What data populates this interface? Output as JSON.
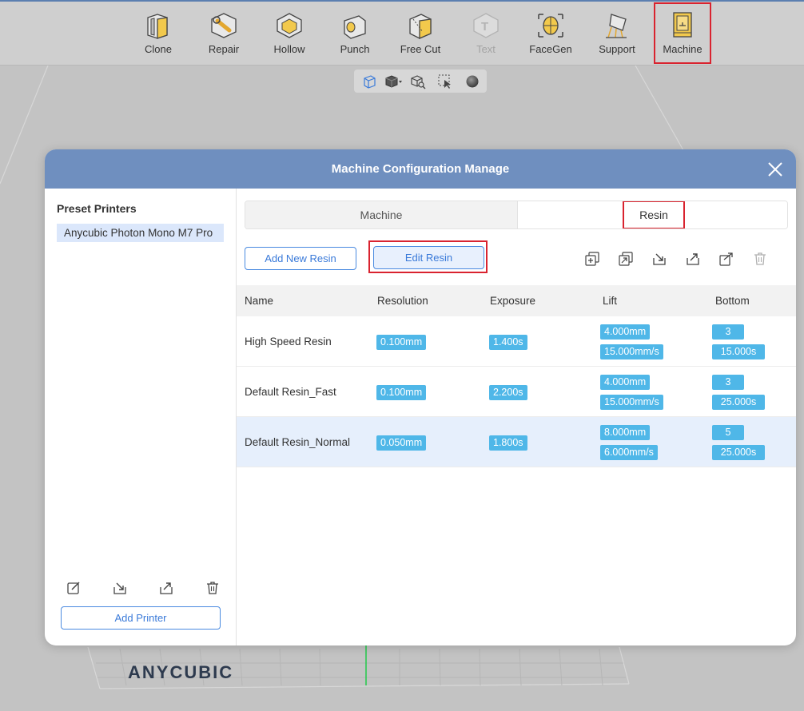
{
  "toolbar": {
    "tools": [
      {
        "label": "Clone",
        "icon": "clone-icon"
      },
      {
        "label": "Repair",
        "icon": "repair-icon"
      },
      {
        "label": "Hollow",
        "icon": "hollow-icon"
      },
      {
        "label": "Punch",
        "icon": "punch-icon"
      },
      {
        "label": "Free Cut",
        "icon": "free-cut-icon"
      },
      {
        "label": "Text",
        "icon": "text-icon",
        "disabled": true
      },
      {
        "label": "FaceGen",
        "icon": "facegen-icon"
      },
      {
        "label": "Support",
        "icon": "support-icon"
      },
      {
        "label": "Machine",
        "icon": "machine-icon",
        "selected": true
      }
    ]
  },
  "viewbar": {
    "icons": [
      "wireframe-view-icon",
      "shaded-view-icon",
      "inspect-view-icon",
      "select-view-icon",
      "sphere-view-icon"
    ]
  },
  "dialog": {
    "title": "Machine Configuration Manage",
    "left": {
      "preset_title": "Preset Printers",
      "printers": [
        "Anycubic Photon Mono M7 Pro"
      ],
      "add_printer": "Add Printer"
    },
    "tabs": {
      "machine": "Machine",
      "resin": "Resin"
    },
    "add_new_resin": "Add New Resin",
    "edit_resin": "Edit Resin",
    "table": {
      "headers": [
        "Name",
        "Resolution",
        "Exposure",
        "Lift",
        "Bottom"
      ],
      "rows": [
        {
          "name": "High Speed Resin",
          "resolution": "0.100mm",
          "exposure": "1.400s",
          "lift_height": "4.000mm",
          "lift_speed": "15.000mm/s",
          "bottom_layers": "3",
          "bottom_exposure": "15.000s"
        },
        {
          "name": "Default Resin_Fast",
          "resolution": "0.100mm",
          "exposure": "2.200s",
          "lift_height": "4.000mm",
          "lift_speed": "15.000mm/s",
          "bottom_layers": "3",
          "bottom_exposure": "25.000s"
        },
        {
          "name": "Default Resin_Normal",
          "resolution": "0.050mm",
          "exposure": "1.800s",
          "lift_height": "8.000mm",
          "lift_speed": "6.000mm/s",
          "bottom_layers": "5",
          "bottom_exposure": "25.000s"
        }
      ]
    }
  },
  "viewport": {
    "brand": "ANYCUBIC"
  },
  "colors": {
    "header": "#6f8fbf",
    "accent": "#3a7ad9",
    "chip": "#4fb7e8",
    "highlight": "#d9232f"
  }
}
